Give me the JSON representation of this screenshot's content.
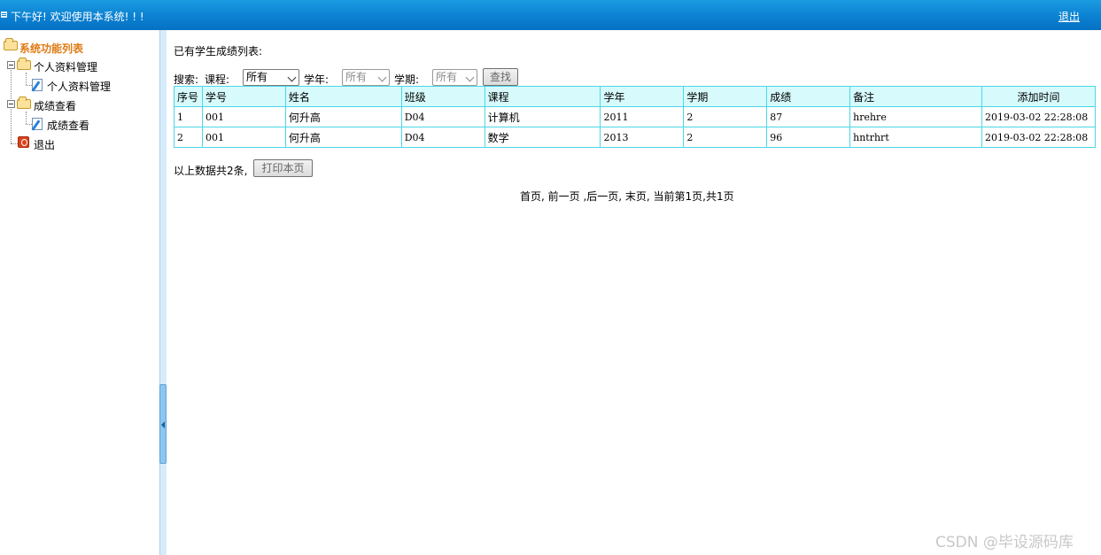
{
  "header": {
    "greeting": "下午好! 欢迎使用本系统! ! !",
    "logout_label": "退出"
  },
  "sidebar": {
    "root_label": "系统功能列表",
    "groups": [
      {
        "label": "个人资料管理",
        "children": [
          {
            "label": "个人资料管理"
          }
        ]
      },
      {
        "label": "成绩查看",
        "children": [
          {
            "label": "成绩查看"
          }
        ]
      }
    ],
    "exit_label": "退出"
  },
  "main": {
    "title": "已有学生成绩列表:",
    "search": {
      "label": "搜索:",
      "course_label": "课程:",
      "course_value": "所有",
      "year_label": "学年:",
      "year_value": "所有",
      "term_label": "学期:",
      "term_value": "所有",
      "find_button": "查找"
    },
    "table": {
      "columns": [
        "序号",
        "学号",
        "姓名",
        "班级",
        "课程",
        "学年",
        "学期",
        "成绩",
        "备注",
        "添加时间"
      ],
      "rows": [
        [
          "1",
          "001",
          "何升高",
          "D04",
          "计算机",
          "2011",
          "2",
          "87",
          "hrehre",
          "2019-03-02 22:28:08"
        ],
        [
          "2",
          "001",
          "何升高",
          "D04",
          "数学",
          "2013",
          "2",
          "96",
          "hntrhrt",
          "2019-03-02 22:28:08"
        ]
      ]
    },
    "summary": "以上数据共2条,",
    "print_button": "打印本页",
    "pager": "首页, 前一页 ,后一页, 末页, 当前第1页,共1页"
  },
  "watermark": "CSDN @毕设源码库"
}
